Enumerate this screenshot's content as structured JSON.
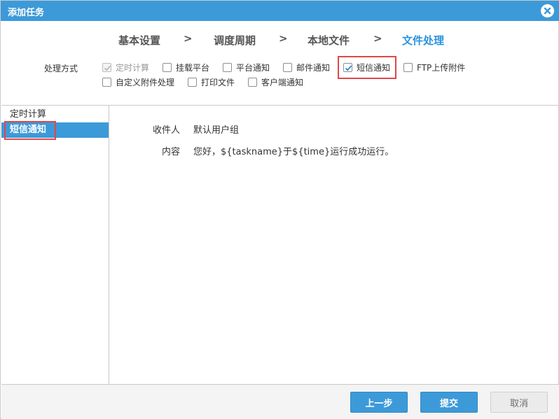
{
  "dialog": {
    "title": "添加任务"
  },
  "steps": [
    {
      "label": "基本设置",
      "active": false
    },
    {
      "label": "调度周期",
      "active": false
    },
    {
      "label": "本地文件",
      "active": false
    },
    {
      "label": "文件处理",
      "active": true
    }
  ],
  "step_separator": ">",
  "processing": {
    "label": "处理方式",
    "options": [
      {
        "label": "定时计算",
        "checked": true,
        "disabled": true
      },
      {
        "label": "挂载平台",
        "checked": false,
        "disabled": false
      },
      {
        "label": "平台通知",
        "checked": false,
        "disabled": false
      },
      {
        "label": "邮件通知",
        "checked": false,
        "disabled": false
      },
      {
        "label": "短信通知",
        "checked": true,
        "disabled": false
      },
      {
        "label": "FTP上传附件",
        "checked": false,
        "disabled": false
      },
      {
        "label": "自定义附件处理",
        "checked": false,
        "disabled": false
      },
      {
        "label": "打印文件",
        "checked": false,
        "disabled": false
      },
      {
        "label": "客户端通知",
        "checked": false,
        "disabled": false
      }
    ]
  },
  "sidebar": {
    "items": [
      {
        "label": "定时计算",
        "selected": false
      },
      {
        "label": "短信通知",
        "selected": true
      }
    ]
  },
  "detail": {
    "recipient_label": "收件人",
    "recipient_value": "默认用户组",
    "content_label": "内容",
    "content_value": "您好，${taskname}于${time}运行成功运行。"
  },
  "footer": {
    "prev_label": "上一步",
    "submit_label": "提交",
    "cancel_label": "取消"
  },
  "colors": {
    "accent": "#3d9ad8",
    "active_step": "#2b93dd",
    "highlight": "#e0474b"
  }
}
